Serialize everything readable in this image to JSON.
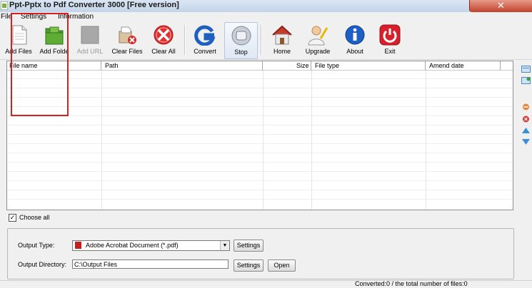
{
  "window": {
    "title": "Ppt-Pptx to Pdf Converter 3000 [Free version]"
  },
  "menu": {
    "items": [
      "File",
      "Settings",
      "Information"
    ]
  },
  "toolbar": {
    "add_files": "Add Files",
    "add_folder": "Add Folde",
    "add_url": "Add URL",
    "clear_files": "Clear Files",
    "clear_all": "Clear All",
    "convert": "Convert",
    "stop": "Stop",
    "home": "Home",
    "upgrade": "Upgrade",
    "about": "About",
    "exit": "Exit"
  },
  "file_list": {
    "columns": [
      "File name",
      "Path",
      "Size",
      "File type",
      "Amend date"
    ],
    "rows": []
  },
  "choose_all": {
    "label": "Choose all",
    "checked": true
  },
  "output": {
    "type_label": "Output Type:",
    "type_value": "Adobe Acrobat Document (*.pdf)",
    "directory_label": "Output Directory:",
    "directory_value": "C:\\Output Files",
    "settings_label": "Settings",
    "open_label": "Open"
  },
  "status": {
    "text": "Converted:0  /  the total number of files:0"
  },
  "colors": {
    "highlight": "#d61f1f",
    "exit_red": "#d8202c",
    "about_blue": "#1d5fc4"
  }
}
